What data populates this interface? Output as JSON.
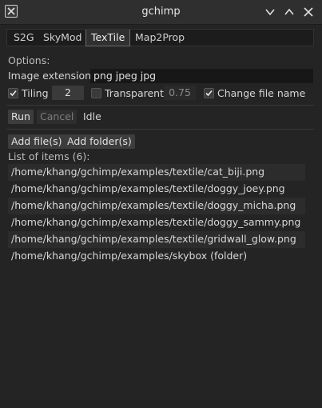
{
  "window": {
    "title": "gchimp"
  },
  "tabs": [
    {
      "label": "S2G",
      "active": false
    },
    {
      "label": "SkyMod",
      "active": false
    },
    {
      "label": "TexTile",
      "active": true
    },
    {
      "label": "Map2Prop",
      "active": false
    }
  ],
  "options": {
    "heading": "Options:",
    "image_extensions_label": "Image extensions",
    "image_extensions_value": "png jpeg jpg",
    "tiling_label": "Tiling",
    "tiling_checked": true,
    "tiling_value": "2",
    "transparent_label": "Transparent",
    "transparent_checked": false,
    "transparent_value": "0.75",
    "change_file_name_label": "Change file name",
    "change_file_name_checked": true
  },
  "actions": {
    "run_label": "Run",
    "cancel_label": "Cancel",
    "status": "Idle",
    "add_files_label": "Add file(s)",
    "add_folder_label": "Add folder(s)"
  },
  "list": {
    "heading": "List of items (6):",
    "items": [
      "/home/khang/gchimp/examples/textile/cat_biji.png",
      "/home/khang/gchimp/examples/textile/doggy_joey.png",
      "/home/khang/gchimp/examples/textile/doggy_micha.png",
      "/home/khang/gchimp/examples/textile/doggy_sammy.png",
      "/home/khang/gchimp/examples/textile/gridwall_glow.png",
      "/home/khang/gchimp/examples/skybox (folder)"
    ]
  },
  "icons": {
    "app": "gchimp-app-icon",
    "minimize": "chevron-down-icon",
    "maximize": "chevron-up-icon",
    "close": "close-icon",
    "check": "check-icon"
  }
}
